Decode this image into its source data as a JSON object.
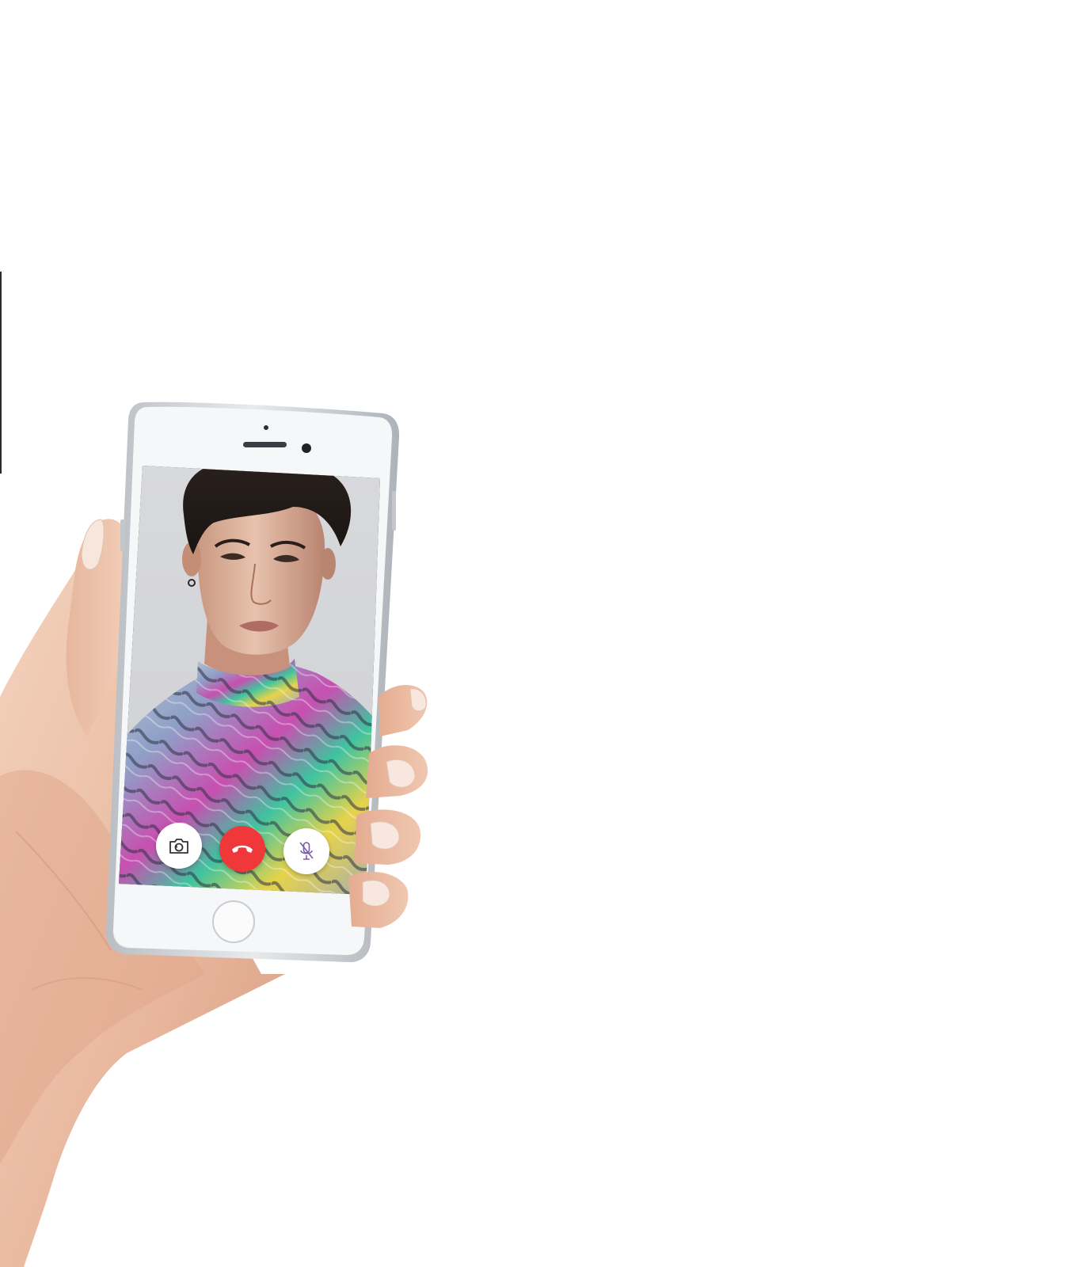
{
  "call": {
    "state": "active-video-call",
    "controls": [
      {
        "id": "switch-camera",
        "icon": "camera-switch-icon"
      },
      {
        "id": "end-call",
        "icon": "phone-hangup-icon",
        "color": "#f0383b"
      },
      {
        "id": "mute",
        "icon": "microphone-muted-icon"
      }
    ]
  },
  "colors": {
    "end_call": "#f0383b",
    "phone_body": "#f4f5f6",
    "phone_frame": "#c8ccd1",
    "screen_background": "#d9dadd"
  }
}
